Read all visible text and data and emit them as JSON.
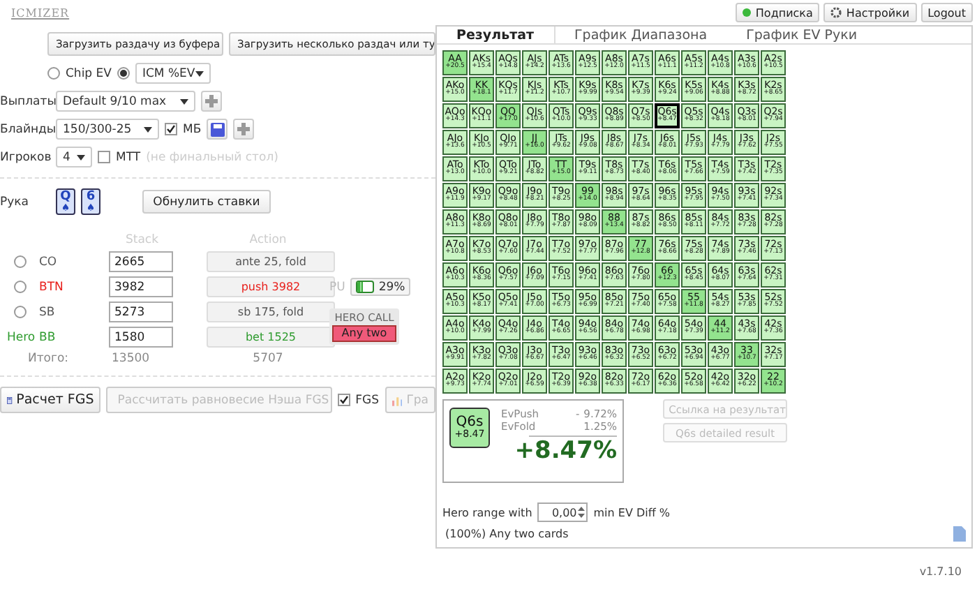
{
  "logo": "ICMIZER",
  "top_buttons": [
    {
      "label": "Подписка",
      "kind": "status"
    },
    {
      "label": "Настройки",
      "kind": "settings"
    },
    {
      "label": "Logout",
      "kind": "plain"
    }
  ],
  "load_buttons": [
    "Загрузить раздачу из буфера",
    "Загрузить несколько раздач или ту"
  ],
  "mode": {
    "options": [
      {
        "label": "Chip EV",
        "selected": false
      },
      {
        "label": "ICM %EV",
        "selected": true
      }
    ]
  },
  "payouts": {
    "label": "Выплаты",
    "value": "Default 9/10 max"
  },
  "blinds": {
    "label": "Блайнды",
    "value": "150/300-25",
    "checkbox": {
      "label": "МБ",
      "checked": true
    }
  },
  "players_count": {
    "label": "Игроков",
    "value": "4",
    "checkbox": {
      "label": "MTT",
      "checked": false
    },
    "note": "(не финальный стол)"
  },
  "hand": {
    "label": "Рука",
    "cards": [
      {
        "rank": "Q",
        "suit": "♠"
      },
      {
        "rank": "6",
        "suit": "♠"
      }
    ],
    "reset_button": "Обнулить ставки"
  },
  "table_headers": {
    "stack": "Stack",
    "action": "Action"
  },
  "players": [
    {
      "kind": "villain",
      "selected": false,
      "position": "CO",
      "color": "#555555",
      "stack": "2665",
      "action": "ante 25, fold"
    },
    {
      "kind": "villain",
      "selected": false,
      "position": "BTN",
      "color": "#e8201c",
      "stack": "3982",
      "action": "push 3982",
      "range": {
        "label": "PU",
        "level": 0.29,
        "reading": "29%"
      }
    },
    {
      "kind": "villain",
      "selected": false,
      "position": "SB",
      "color": "#555555",
      "stack": "5273",
      "action": "sb 175, fold"
    },
    {
      "kind": "hero",
      "hero_label": "Hero",
      "position": "BB",
      "color": "#2e9b2e",
      "stack": "1580",
      "action": "bet 1525",
      "call": {
        "title": "HERO CALL",
        "button": "Any two"
      }
    }
  ],
  "totals": {
    "label": "Итого:",
    "stack": "13500",
    "action": "5707"
  },
  "bottom_buttons": [
    {
      "label": "Расчет FGS",
      "kind": "calc",
      "disabled": false
    },
    {
      "label": "Рассчитать равновесие Нэша FGS",
      "kind": "nash",
      "disabled": true
    },
    {
      "label": "FGS",
      "kind": "checkbox",
      "checked": true
    },
    {
      "label": "Гра",
      "kind": "chart",
      "disabled": true
    }
  ],
  "tabs": [
    {
      "label": "Результат",
      "selected": true
    },
    {
      "label": "График Диапазона",
      "selected": false
    },
    {
      "label": "График EV Руки",
      "selected": false
    }
  ],
  "grid": [
    [
      {
        "hand": "AA",
        "ev": "+20.5",
        "selected": false
      },
      {
        "hand": "AKs",
        "ev": "+15.4",
        "selected": false
      },
      {
        "hand": "AQs",
        "ev": "+14.8",
        "selected": false
      },
      {
        "hand": "AJs",
        "ev": "+14.2",
        "selected": false
      },
      {
        "hand": "ATs",
        "ev": "+13.6",
        "selected": false
      },
      {
        "hand": "A9s",
        "ev": "+12.5",
        "selected": false
      },
      {
        "hand": "A8s",
        "ev": "+12.0",
        "selected": false
      },
      {
        "hand": "A7s",
        "ev": "+11.5",
        "selected": false
      },
      {
        "hand": "A6s",
        "ev": "+11.1",
        "selected": false
      },
      {
        "hand": "A5s",
        "ev": "+11.2",
        "selected": false
      },
      {
        "hand": "A4s",
        "ev": "+10.8",
        "selected": false
      },
      {
        "hand": "A3s",
        "ev": "+10.6",
        "selected": false
      },
      {
        "hand": "A2s",
        "ev": "+10.5",
        "selected": false
      }
    ],
    [
      {
        "hand": "AKo",
        "ev": "+15.0",
        "selected": false
      },
      {
        "hand": "KK",
        "ev": "+18.1",
        "selected": false
      },
      {
        "hand": "KQs",
        "ev": "+11.7",
        "selected": false
      },
      {
        "hand": "KJs",
        "ev": "+11.2",
        "selected": false
      },
      {
        "hand": "KTs",
        "ev": "+10.7",
        "selected": false
      },
      {
        "hand": "K9s",
        "ev": "+9.99",
        "selected": false
      },
      {
        "hand": "K8s",
        "ev": "+9.54",
        "selected": false
      },
      {
        "hand": "K7s",
        "ev": "+9.39",
        "selected": false
      },
      {
        "hand": "K6s",
        "ev": "+9.24",
        "selected": false
      },
      {
        "hand": "K5s",
        "ev": "+9.06",
        "selected": false
      },
      {
        "hand": "K4s",
        "ev": "+8.88",
        "selected": false
      },
      {
        "hand": "K3s",
        "ev": "+8.72",
        "selected": false
      },
      {
        "hand": "K2s",
        "ev": "+8.65",
        "selected": false
      }
    ],
    [
      {
        "hand": "AQo",
        "ev": "+14.3",
        "selected": false
      },
      {
        "hand": "KQo",
        "ev": "+11.1",
        "selected": false
      },
      {
        "hand": "QQ",
        "ev": "+17.0",
        "selected": false
      },
      {
        "hand": "QJs",
        "ev": "+10.6",
        "selected": false
      },
      {
        "hand": "QTs",
        "ev": "+10.0",
        "selected": false
      },
      {
        "hand": "Q9s",
        "ev": "+9.33",
        "selected": false
      },
      {
        "hand": "Q8s",
        "ev": "+8.89",
        "selected": false
      },
      {
        "hand": "Q7s",
        "ev": "+8.50",
        "selected": false
      },
      {
        "hand": "Q6s",
        "ev": "+8.47",
        "selected": true
      },
      {
        "hand": "Q5s",
        "ev": "+8.32",
        "selected": false
      },
      {
        "hand": "Q4s",
        "ev": "+8.18",
        "selected": false
      },
      {
        "hand": "Q3s",
        "ev": "+8.01",
        "selected": false
      },
      {
        "hand": "Q2s",
        "ev": "+7.94",
        "selected": false
      }
    ],
    [
      {
        "hand": "AJo",
        "ev": "+13.6",
        "selected": false
      },
      {
        "hand": "KJo",
        "ev": "+10.5",
        "selected": false
      },
      {
        "hand": "QJo",
        "ev": "+9.71",
        "selected": false
      },
      {
        "hand": "JJ",
        "ev": "+16.0",
        "selected": false
      },
      {
        "hand": "JTs",
        "ev": "+9.62",
        "selected": false
      },
      {
        "hand": "J9s",
        "ev": "+9.08",
        "selected": false
      },
      {
        "hand": "J8s",
        "ev": "+8.67",
        "selected": false
      },
      {
        "hand": "J7s",
        "ev": "+8.34",
        "selected": false
      },
      {
        "hand": "J6s",
        "ev": "+8.01",
        "selected": false
      },
      {
        "hand": "J5s",
        "ev": "+7.93",
        "selected": false
      },
      {
        "hand": "J4s",
        "ev": "+7.79",
        "selected": false
      },
      {
        "hand": "J3s",
        "ev": "+7.62",
        "selected": false
      },
      {
        "hand": "J2s",
        "ev": "+7.55",
        "selected": false
      }
    ],
    [
      {
        "hand": "ATo",
        "ev": "+13.0",
        "selected": false
      },
      {
        "hand": "KTo",
        "ev": "+10.0",
        "selected": false
      },
      {
        "hand": "QTo",
        "ev": "+9.21",
        "selected": false
      },
      {
        "hand": "JTo",
        "ev": "+8.82",
        "selected": false
      },
      {
        "hand": "TT",
        "ev": "+15.0",
        "selected": false
      },
      {
        "hand": "T9s",
        "ev": "+9.11",
        "selected": false
      },
      {
        "hand": "T8s",
        "ev": "+8.73",
        "selected": false
      },
      {
        "hand": "T7s",
        "ev": "+8.40",
        "selected": false
      },
      {
        "hand": "T6s",
        "ev": "+8.06",
        "selected": false
      },
      {
        "hand": "T5s",
        "ev": "+7.66",
        "selected": false
      },
      {
        "hand": "T4s",
        "ev": "+7.59",
        "selected": false
      },
      {
        "hand": "T3s",
        "ev": "+7.42",
        "selected": false
      },
      {
        "hand": "T2s",
        "ev": "+7.35",
        "selected": false
      }
    ],
    [
      {
        "hand": "A9o",
        "ev": "+11.9",
        "selected": false
      },
      {
        "hand": "K9o",
        "ev": "+9.17",
        "selected": false
      },
      {
        "hand": "Q9o",
        "ev": "+8.48",
        "selected": false
      },
      {
        "hand": "J9o",
        "ev": "+8.21",
        "selected": false
      },
      {
        "hand": "T9o",
        "ev": "+8.25",
        "selected": false
      },
      {
        "hand": "99",
        "ev": "+14.0",
        "selected": false
      },
      {
        "hand": "98s",
        "ev": "+8.94",
        "selected": false
      },
      {
        "hand": "97s",
        "ev": "+8.64",
        "selected": false
      },
      {
        "hand": "96s",
        "ev": "+8.35",
        "selected": false
      },
      {
        "hand": "95s",
        "ev": "+7.95",
        "selected": false
      },
      {
        "hand": "94s",
        "ev": "+7.50",
        "selected": false
      },
      {
        "hand": "93s",
        "ev": "+7.41",
        "selected": false
      },
      {
        "hand": "92s",
        "ev": "+7.34",
        "selected": false
      }
    ],
    [
      {
        "hand": "A8o",
        "ev": "+11.3",
        "selected": false
      },
      {
        "hand": "K8o",
        "ev": "+8.69",
        "selected": false
      },
      {
        "hand": "Q8o",
        "ev": "+8.01",
        "selected": false
      },
      {
        "hand": "J8o",
        "ev": "+7.79",
        "selected": false
      },
      {
        "hand": "T8o",
        "ev": "+7.87",
        "selected": false
      },
      {
        "hand": "98o",
        "ev": "+8.09",
        "selected": false
      },
      {
        "hand": "88",
        "ev": "+13.4",
        "selected": false
      },
      {
        "hand": "87s",
        "ev": "+8.82",
        "selected": false
      },
      {
        "hand": "86s",
        "ev": "+8.50",
        "selected": false
      },
      {
        "hand": "85s",
        "ev": "+8.11",
        "selected": false
      },
      {
        "hand": "84s",
        "ev": "+7.72",
        "selected": false
      },
      {
        "hand": "83s",
        "ev": "+7.28",
        "selected": false
      },
      {
        "hand": "82s",
        "ev": "+7.28",
        "selected": false
      }
    ],
    [
      {
        "hand": "A7o",
        "ev": "+10.8",
        "selected": false
      },
      {
        "hand": "K7o",
        "ev": "+8.53",
        "selected": false
      },
      {
        "hand": "Q7o",
        "ev": "+7.60",
        "selected": false
      },
      {
        "hand": "J7o",
        "ev": "+7.44",
        "selected": false
      },
      {
        "hand": "T7o",
        "ev": "+7.52",
        "selected": false
      },
      {
        "hand": "97o",
        "ev": "+7.77",
        "selected": false
      },
      {
        "hand": "87o",
        "ev": "+7.96",
        "selected": false
      },
      {
        "hand": "77",
        "ev": "+12.8",
        "selected": false
      },
      {
        "hand": "76s",
        "ev": "+8.66",
        "selected": false
      },
      {
        "hand": "75s",
        "ev": "+8.28",
        "selected": false
      },
      {
        "hand": "74s",
        "ev": "+7.89",
        "selected": false
      },
      {
        "hand": "73s",
        "ev": "+7.46",
        "selected": false
      },
      {
        "hand": "72s",
        "ev": "+7.13",
        "selected": false
      }
    ],
    [
      {
        "hand": "A6o",
        "ev": "+10.3",
        "selected": false
      },
      {
        "hand": "K6o",
        "ev": "+8.36",
        "selected": false
      },
      {
        "hand": "Q6o",
        "ev": "+7.57",
        "selected": false
      },
      {
        "hand": "J6o",
        "ev": "+7.09",
        "selected": false
      },
      {
        "hand": "T6o",
        "ev": "+7.15",
        "selected": false
      },
      {
        "hand": "96o",
        "ev": "+7.41",
        "selected": false
      },
      {
        "hand": "86o",
        "ev": "+7.63",
        "selected": false
      },
      {
        "hand": "76o",
        "ev": "+7.80",
        "selected": false
      },
      {
        "hand": "66",
        "ev": "+12.3",
        "selected": false
      },
      {
        "hand": "65s",
        "ev": "+8.45",
        "selected": false
      },
      {
        "hand": "64s",
        "ev": "+8.07",
        "selected": false
      },
      {
        "hand": "63s",
        "ev": "+7.64",
        "selected": false
      },
      {
        "hand": "62s",
        "ev": "+7.31",
        "selected": false
      }
    ],
    [
      {
        "hand": "A5o",
        "ev": "+10.3",
        "selected": false
      },
      {
        "hand": "K5o",
        "ev": "+8.17",
        "selected": false
      },
      {
        "hand": "Q5o",
        "ev": "+7.41",
        "selected": false
      },
      {
        "hand": "J5o",
        "ev": "+7.00",
        "selected": false
      },
      {
        "hand": "T5o",
        "ev": "+6.73",
        "selected": false
      },
      {
        "hand": "95o",
        "ev": "+6.99",
        "selected": false
      },
      {
        "hand": "85o",
        "ev": "+7.21",
        "selected": false
      },
      {
        "hand": "75o",
        "ev": "+7.40",
        "selected": false
      },
      {
        "hand": "65o",
        "ev": "+7.58",
        "selected": false
      },
      {
        "hand": "55",
        "ev": "+11.8",
        "selected": false
      },
      {
        "hand": "54s",
        "ev": "+8.27",
        "selected": false
      },
      {
        "hand": "53s",
        "ev": "+7.85",
        "selected": false
      },
      {
        "hand": "52s",
        "ev": "+7.52",
        "selected": false
      }
    ],
    [
      {
        "hand": "A4o",
        "ev": "+10.0",
        "selected": false
      },
      {
        "hand": "K4o",
        "ev": "+7.99",
        "selected": false
      },
      {
        "hand": "Q4o",
        "ev": "+7.26",
        "selected": false
      },
      {
        "hand": "J4o",
        "ev": "+6.86",
        "selected": false
      },
      {
        "hand": "T4o",
        "ev": "+6.65",
        "selected": false
      },
      {
        "hand": "94o",
        "ev": "+6.56",
        "selected": false
      },
      {
        "hand": "84o",
        "ev": "+6.78",
        "selected": false
      },
      {
        "hand": "74o",
        "ev": "+6.98",
        "selected": false
      },
      {
        "hand": "64o",
        "ev": "+7.18",
        "selected": false
      },
      {
        "hand": "54o",
        "ev": "+7.39",
        "selected": false
      },
      {
        "hand": "44",
        "ev": "+11.2",
        "selected": false
      },
      {
        "hand": "43s",
        "ev": "+7.68",
        "selected": false
      },
      {
        "hand": "42s",
        "ev": "+7.36",
        "selected": false
      }
    ],
    [
      {
        "hand": "A3o",
        "ev": "+9.91",
        "selected": false
      },
      {
        "hand": "K3o",
        "ev": "+7.82",
        "selected": false
      },
      {
        "hand": "Q3o",
        "ev": "+7.08",
        "selected": false
      },
      {
        "hand": "J3o",
        "ev": "+6.67",
        "selected": false
      },
      {
        "hand": "T3o",
        "ev": "+6.47",
        "selected": false
      },
      {
        "hand": "93o",
        "ev": "+6.46",
        "selected": false
      },
      {
        "hand": "83o",
        "ev": "+6.32",
        "selected": false
      },
      {
        "hand": "73o",
        "ev": "+6.52",
        "selected": false
      },
      {
        "hand": "63o",
        "ev": "+6.72",
        "selected": false
      },
      {
        "hand": "53o",
        "ev": "+6.94",
        "selected": false
      },
      {
        "hand": "43o",
        "ev": "+6.77",
        "selected": false
      },
      {
        "hand": "33",
        "ev": "+10.7",
        "selected": false
      },
      {
        "hand": "32s",
        "ev": "+7.17",
        "selected": false
      }
    ],
    [
      {
        "hand": "A2o",
        "ev": "+9.73",
        "selected": false
      },
      {
        "hand": "K2o",
        "ev": "+7.74",
        "selected": false
      },
      {
        "hand": "Q2o",
        "ev": "+7.01",
        "selected": false
      },
      {
        "hand": "J2o",
        "ev": "+6.59",
        "selected": false
      },
      {
        "hand": "T2o",
        "ev": "+6.39",
        "selected": false
      },
      {
        "hand": "92o",
        "ev": "+6.38",
        "selected": false
      },
      {
        "hand": "82o",
        "ev": "+6.33",
        "selected": false
      },
      {
        "hand": "72o",
        "ev": "+6.17",
        "selected": false
      },
      {
        "hand": "62o",
        "ev": "+6.36",
        "selected": false
      },
      {
        "hand": "52o",
        "ev": "+6.58",
        "selected": false
      },
      {
        "hand": "42o",
        "ev": "+6.42",
        "selected": false
      },
      {
        "hand": "32o",
        "ev": "+6.22",
        "selected": false
      },
      {
        "hand": "22",
        "ev": "+10.2",
        "selected": false
      }
    ]
  ],
  "result": {
    "hand": "Q6s",
    "ev": "+8.47",
    "rows": [
      {
        "label": "EvPush",
        "value": "9.72%"
      },
      {
        "label": "EvFold",
        "value": "1.25%"
      }
    ],
    "operator": "-",
    "total": "+8.47%"
  },
  "result_buttons": [
    {
      "label": "Ссылка на результат",
      "kind": "link",
      "disabled": true
    },
    {
      "label": "Q6s detailed result",
      "kind": "plain",
      "disabled": true
    }
  ],
  "hero_range": {
    "prefix": "Hero range with",
    "value": "0,00",
    "suffix": "min EV Diff %",
    "summary": "(100%) Any two cards"
  },
  "version": "v1.7.10"
}
